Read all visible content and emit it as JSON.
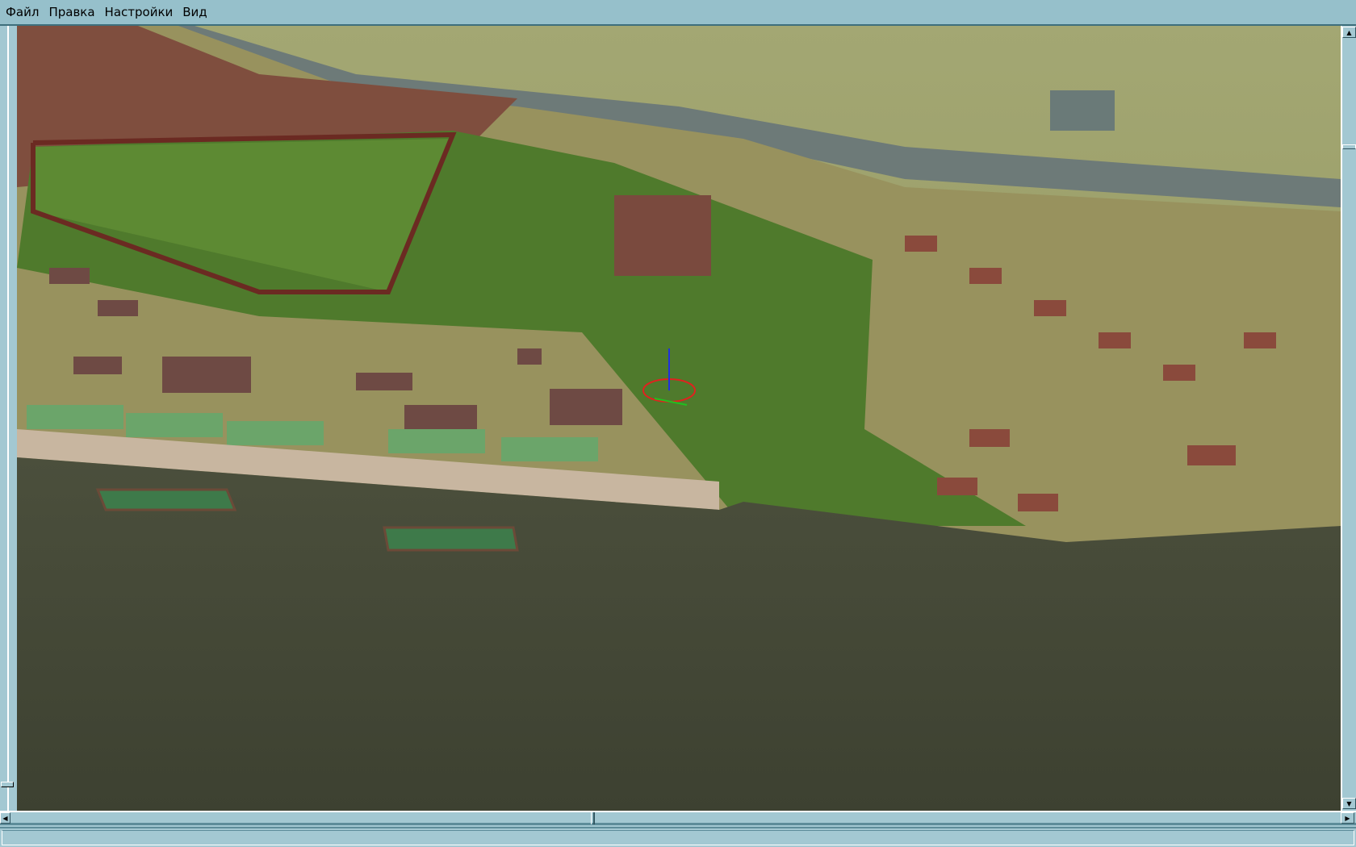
{
  "menu": {
    "items": [
      {
        "label": "Файл"
      },
      {
        "label": "Правка"
      },
      {
        "label": "Настройки"
      },
      {
        "label": "Вид"
      }
    ]
  },
  "viewport": {
    "scene": "3d-city-riverfront"
  },
  "scrollbars": {
    "vertical_position": 0.12,
    "horizontal_position": 0.44
  },
  "statusbar": {
    "text": ""
  }
}
